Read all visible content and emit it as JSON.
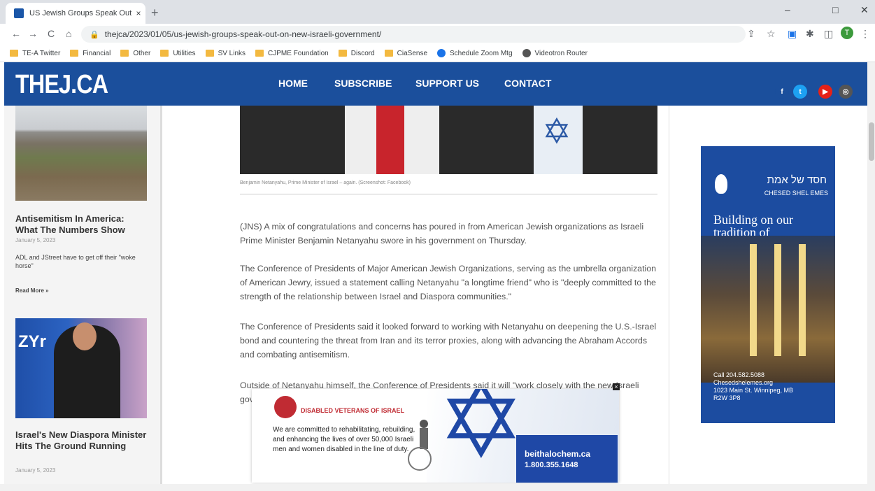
{
  "browser": {
    "tab_title": "US Jewish Groups Speak Out On",
    "tab_close": "×",
    "new_tab": "+",
    "url": "thejca/2023/01/05/us-jewish-groups-speak-out-on-new-israeli-government/",
    "profile_initial": "T",
    "window_controls": [
      "–",
      "□",
      "✕"
    ],
    "nav_icons": [
      "←",
      "→",
      "C",
      "⌂"
    ],
    "bookmarks": [
      {
        "label": "TE-A Twitter",
        "icon": "folder"
      },
      {
        "label": "Financial",
        "icon": "folder"
      },
      {
        "label": "Other",
        "icon": "folder"
      },
      {
        "label": "Utilities",
        "icon": "folder"
      },
      {
        "label": "SV Links",
        "icon": "folder"
      },
      {
        "label": "CJPME Foundation",
        "icon": "folder"
      },
      {
        "label": "Discord",
        "icon": "folder"
      },
      {
        "label": "CiaSense",
        "icon": "folder"
      },
      {
        "label": "Schedule Zoom Mtg",
        "icon": "globe"
      },
      {
        "label": "Videotron Router",
        "icon": "gear"
      }
    ]
  },
  "site": {
    "logo": "THEJ.CA",
    "nav": [
      "HOME",
      "SUBSCRIBE",
      "SUPPORT US",
      "CONTACT"
    ],
    "social": [
      {
        "name": "facebook",
        "glyph": "f",
        "color": "#1b4f9c"
      },
      {
        "name": "twitter",
        "glyph": "t",
        "color": "#1da1f2"
      },
      {
        "name": "youtube",
        "glyph": "▶",
        "color": "#e62117"
      },
      {
        "name": "instagram",
        "glyph": "◎",
        "color": "#555555"
      }
    ]
  },
  "sidebar": {
    "posts": [
      {
        "title": "Antisemitism In America: What The Numbers Show",
        "date": "January 5, 2023",
        "excerpt": "ADL and JStreet have to get off their \"woke horse\"",
        "read_more": "Read More »"
      },
      {
        "title": "Israel's New Diaspora Minister Hits The Ground Running",
        "date": "January 5, 2023",
        "image_text": "ZYr"
      }
    ]
  },
  "article": {
    "caption": "Benjamin Netanyahu, Prime Minister of Israel – again. (Screenshot: Facebook)",
    "paragraphs": [
      "(JNS) A mix of congratulations and concerns has poured in from American Jewish organizations as Israeli Prime Minister Benjamin Netanyahu swore in his government on Thursday.",
      "The Conference of Presidents of Major American Jewish Organizations, serving as the umbrella organization of American Jewry, issued a statement calling Netanyahu \"a longtime friend\" who is \"deeply committed to the strength of the relationship between Israel and Diaspora communities.\"",
      "The Conference of Presidents said it looked forward to working with Netanyahu on deepening the U.S.-Israel bond and countering the threat from Iran and its terror proxies, along with advancing the Abraham Accords and combating antisemitism.",
      "Outside of Netanyahu himself, the Conference of Presidents said it will \"work closely with the new Israeli government to"
    ]
  },
  "right_ad": {
    "hebrew": "חסד של אמת",
    "name": "CHESED SHEL EMES",
    "headline": "Building on our tradition of lovingkindness.",
    "phone": "Call 204.582.5088",
    "web": "Chesedshelemes.org",
    "address": "1023 Main St. Winnipeg, MB",
    "postal": "R2W 3P8"
  },
  "overlay_ad": {
    "org": "DISABLED VETERANS OF ISRAEL",
    "text": "We are committed to rehabilitating, rebuilding, and enhancing the lives of over 50,000 Israeli men and women disabled in the line of duty.",
    "url": "beithalochem.ca",
    "phone": "1.800.355.1648",
    "close": "×"
  }
}
